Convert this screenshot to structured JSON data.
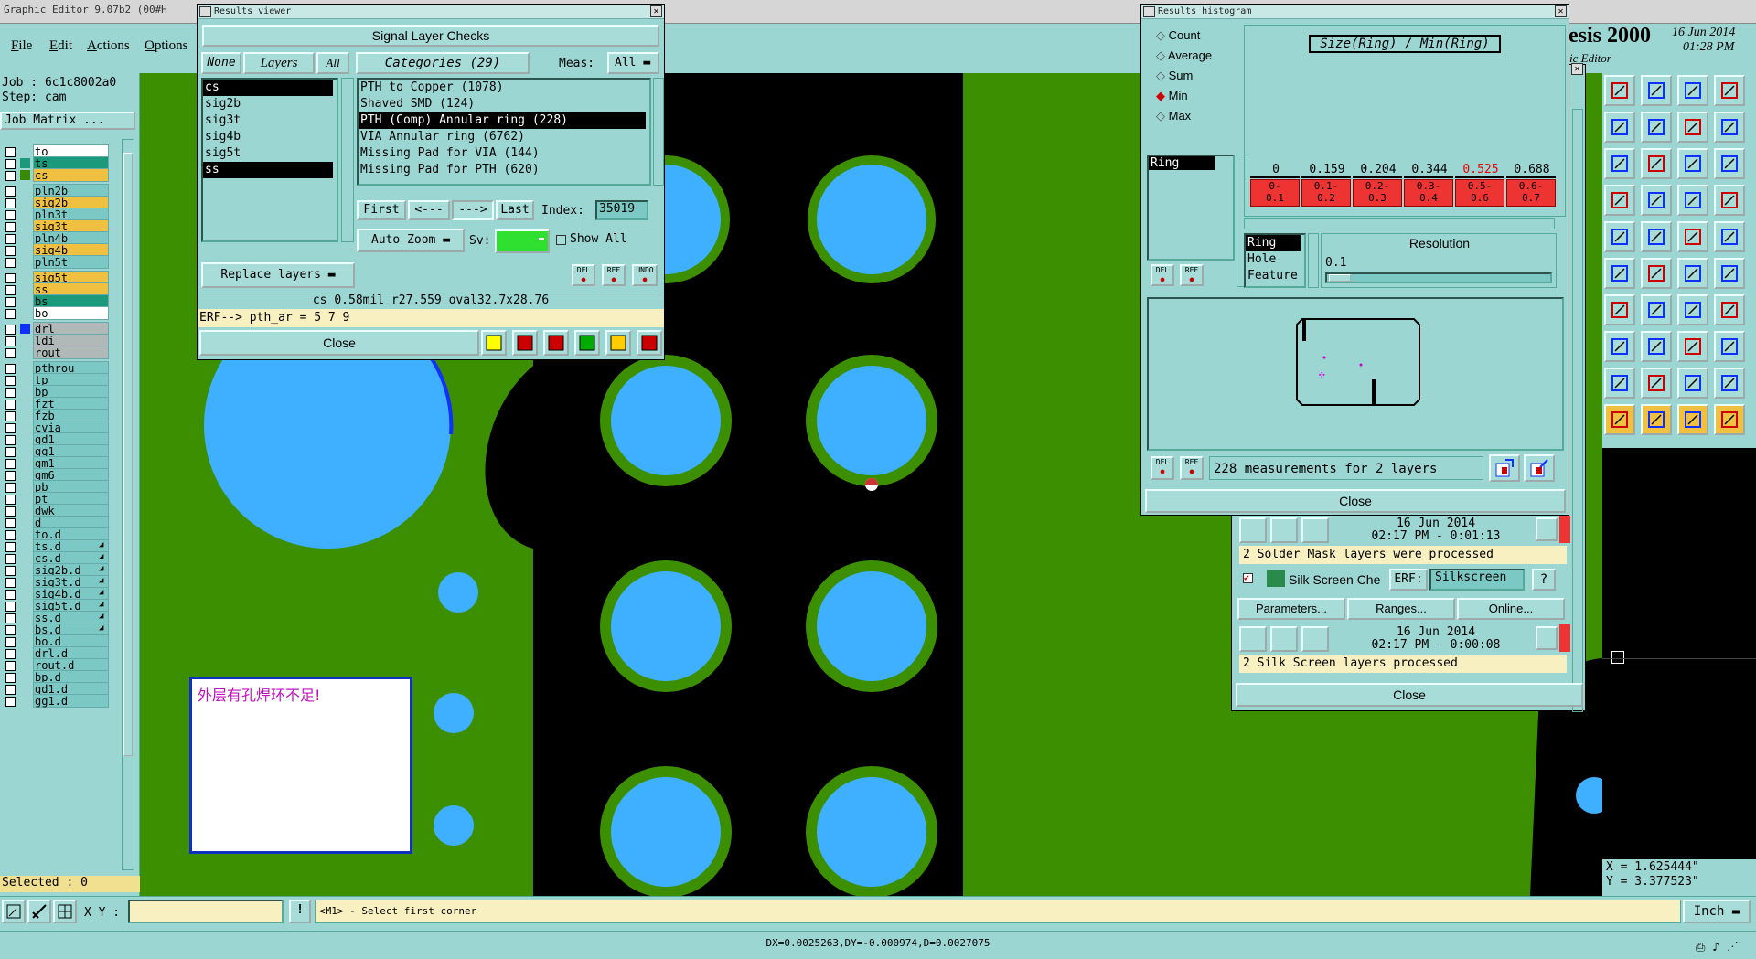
{
  "app": {
    "title": "Graphic Editor 9.07b2 (00#H",
    "menu": [
      "File",
      "Edit",
      "Actions",
      "Options"
    ],
    "brand": "esis 2000",
    "brand_date": "16 Jun 2014",
    "brand_time": "01:28 PM",
    "brand_sub": "ic Editor"
  },
  "left_panel": {
    "job": "Job : 6c1c8002a0",
    "step": "Step: cam",
    "job_matrix_button": "Job Matrix ...",
    "layers": [
      {
        "name": "to",
        "color": "#ffffff",
        "swatch": ""
      },
      {
        "name": "ts",
        "color": "#1a9a7a",
        "swatch": "#1a9a7a"
      },
      {
        "name": "cs",
        "color": "#f0c040",
        "swatch": "#3a8a00"
      },
      {
        "name": "pln2b",
        "color": "#7cc8c4",
        "swatch": ""
      },
      {
        "name": "sig2b",
        "color": "#f0c040",
        "swatch": ""
      },
      {
        "name": "pln3t",
        "color": "#7cc8c4",
        "swatch": ""
      },
      {
        "name": "sig3t",
        "color": "#f0c040",
        "swatch": ""
      },
      {
        "name": "pln4b",
        "color": "#7cc8c4",
        "swatch": ""
      },
      {
        "name": "sig4b",
        "color": "#f0c040",
        "swatch": ""
      },
      {
        "name": "pln5t",
        "color": "#7cc8c4",
        "swatch": ""
      },
      {
        "name": "sig5t",
        "color": "#f0c040",
        "swatch": ""
      },
      {
        "name": "ss",
        "color": "#f0c040",
        "swatch": ""
      },
      {
        "name": "bs",
        "color": "#1a9a7a",
        "swatch": ""
      },
      {
        "name": "bo",
        "color": "#ffffff",
        "swatch": ""
      },
      {
        "name": "drl",
        "color": "#b0b8b8",
        "swatch": "#1030ff"
      },
      {
        "name": "ldi",
        "color": "#b0b8b8",
        "swatch": ""
      },
      {
        "name": "rout",
        "color": "#b0b8b8",
        "swatch": ""
      },
      {
        "name": "pthrou",
        "color": "#7cc8c4",
        "swatch": ""
      },
      {
        "name": "tp",
        "color": "#7cc8c4",
        "swatch": ""
      },
      {
        "name": "bp",
        "color": "#7cc8c4",
        "swatch": ""
      },
      {
        "name": "fzt",
        "color": "#7cc8c4",
        "swatch": ""
      },
      {
        "name": "fzb",
        "color": "#7cc8c4",
        "swatch": ""
      },
      {
        "name": "cvia",
        "color": "#7cc8c4",
        "swatch": ""
      },
      {
        "name": "gd1",
        "color": "#7cc8c4",
        "swatch": ""
      },
      {
        "name": "gg1",
        "color": "#7cc8c4",
        "swatch": ""
      },
      {
        "name": "gm1",
        "color": "#7cc8c4",
        "swatch": ""
      },
      {
        "name": "gm6",
        "color": "#7cc8c4",
        "swatch": ""
      },
      {
        "name": "pb",
        "color": "#7cc8c4",
        "swatch": ""
      },
      {
        "name": "pt",
        "color": "#7cc8c4",
        "swatch": ""
      },
      {
        "name": "dwk",
        "color": "#7cc8c4",
        "swatch": ""
      },
      {
        "name": "d",
        "color": "#7cc8c4",
        "swatch": ""
      },
      {
        "name": "to.d",
        "color": "#7cc8c4",
        "swatch": ""
      },
      {
        "name": "ts.d",
        "color": "#7cc8c4",
        "swatch": "",
        "extra": "◢"
      },
      {
        "name": "cs.d",
        "color": "#7cc8c4",
        "swatch": "",
        "extra": "◢"
      },
      {
        "name": "sig2b.d",
        "color": "#7cc8c4",
        "swatch": "",
        "extra": "◢"
      },
      {
        "name": "sig3t.d",
        "color": "#7cc8c4",
        "swatch": "",
        "extra": "◢"
      },
      {
        "name": "sig4b.d",
        "color": "#7cc8c4",
        "swatch": "",
        "extra": "◢"
      },
      {
        "name": "sig5t.d",
        "color": "#7cc8c4",
        "swatch": "",
        "extra": "◢"
      },
      {
        "name": "ss.d",
        "color": "#7cc8c4",
        "swatch": "",
        "extra": "◢"
      },
      {
        "name": "bs.d",
        "color": "#7cc8c4",
        "swatch": "",
        "extra": "◢"
      },
      {
        "name": "bo.d",
        "color": "#7cc8c4",
        "swatch": ""
      },
      {
        "name": "drl.d",
        "color": "#7cc8c4",
        "swatch": ""
      },
      {
        "name": "rout.d",
        "color": "#7cc8c4",
        "swatch": ""
      },
      {
        "name": "bp.d",
        "color": "#7cc8c4",
        "swatch": ""
      },
      {
        "name": "gd1.d",
        "color": "#7cc8c4",
        "swatch": ""
      },
      {
        "name": "gg1.d",
        "color": "#7cc8c4",
        "swatch": ""
      }
    ],
    "selected": "Selected : 0"
  },
  "canvas": {
    "note": "外层有孔焊环不足!"
  },
  "results_viewer": {
    "title": "Results viewer",
    "header": "Signal Layer Checks",
    "none_btn": "None",
    "layers_btn": "Layers",
    "all_btn": "All",
    "categories_btn": "Categories (29)",
    "meas_label": "Meas:",
    "meas_value": "All",
    "layers": [
      "cs",
      "sig2b",
      "sig3t",
      "sig4b",
      "sig5t",
      "ss"
    ],
    "selected_layers": [
      "cs",
      "ss"
    ],
    "categories": [
      "PTH to Copper (1078)",
      "Shaved SMD (124)",
      "PTH (Comp) Annular ring (228)",
      "VIA Annular ring (6762)",
      "Missing Pad for VIA (144)",
      "Missing Pad for PTH (620)"
    ],
    "selected_category": "PTH (Comp) Annular ring (228)",
    "first_btn": "First",
    "prev_btn": "<---",
    "next_btn": "--->",
    "last_btn": "Last",
    "index_label": "Index:",
    "index_value": "35019",
    "auto_zoom": "Auto Zoom",
    "sv_label": "Sv:",
    "show_all": "Show All",
    "replace_layers": "Replace layers",
    "del": "DEL",
    "ref": "REF",
    "undo": "UNDO",
    "status": "cs 0.58mil  r27.559  oval32.7x28.76",
    "erf": "ERF--> pth_ar = 5 7 9",
    "close": "Close"
  },
  "histogram": {
    "title": "Results histogram",
    "options": [
      "Count",
      "Average",
      "Sum",
      "Min",
      "Max"
    ],
    "selected_option": "Min",
    "chart_title": "Size(Ring) / Min(Ring)",
    "layer_item": "Ring",
    "values": [
      "0",
      "0.159",
      "0.204",
      "0.344",
      "0.525",
      "0.688"
    ],
    "highlight_value": "0.525",
    "bins": [
      "0-\n0.1",
      "0.1-\n0.2",
      "0.2-\n0.3",
      "0.3-\n0.4",
      "0.5-\n0.6",
      "0.6-\n0.7"
    ],
    "features": [
      "Ring",
      "Hole",
      "Feature"
    ],
    "resolution_label": "Resolution",
    "resolution_value": "0.1",
    "measurements": "228 measurements for 2 layers",
    "del": "DEL",
    "ref": "REF",
    "close": "Close"
  },
  "analysis_panel": {
    "date1": "16 Jun 2014",
    "time1": "02:17 PM - 0:01:13",
    "msg1": "2 Solder Mask layers were processed",
    "silk_label": "Silk Screen Che",
    "erf_label": "ERF:",
    "erf_value": "Silkscreen",
    "help": "?",
    "parameters": "Parameters...",
    "ranges": "Ranges...",
    "online": "Online...",
    "date2": "16 Jun 2014",
    "time2": "02:17 PM - 0:00:08",
    "msg2": "2 Silk Screen layers processed",
    "close": "Close"
  },
  "command_bar": {
    "xy_label": "X Y :",
    "prompt": "<M1> - Select first corner",
    "units": "Inch"
  },
  "coords": {
    "x": "X = 1.625444\"",
    "y": "Y = 3.377523\""
  },
  "status_bar": {
    "text": "DX=0.0025263,DY=-0.000974,D=0.0027075"
  }
}
